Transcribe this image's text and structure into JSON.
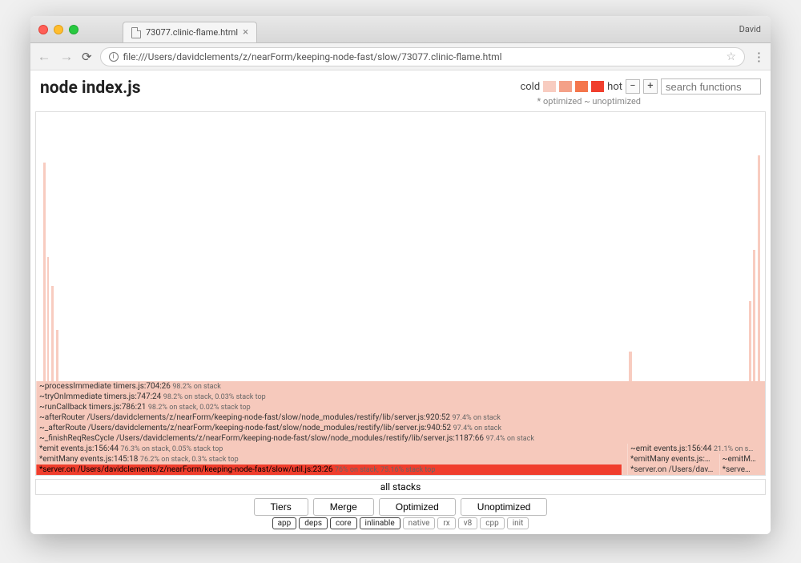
{
  "browser": {
    "tab_title": "73077.clinic-flame.html",
    "user": "David",
    "url": "file:///Users/davidclements/z/nearForm/keeping-node-fast/slow/73077.clinic-flame.html"
  },
  "header": {
    "title": "node index.js",
    "cold_label": "cold",
    "hot_label": "hot",
    "minus": "−",
    "plus": "+",
    "search_placeholder": "search functions",
    "legend_sub": "* optimized ~ unoptimized"
  },
  "frames": [
    {
      "cols": [
        {
          "text": "*server.on /Users/davidclements/z/nearForm/keeping-node-fast/slow/util.js:23:26",
          "meta": "76% on stack, 75.16% stack top",
          "width": "80.4%",
          "class": "chot"
        },
        {
          "text": "",
          "meta": "",
          "width": "0.7%",
          "class": "c0"
        },
        {
          "text": "*server.on /Users/dav…",
          "meta": "",
          "width": "12.6%",
          "class": "c0"
        },
        {
          "text": "*serve…",
          "meta": "",
          "width": "6.3%",
          "class": "c0"
        }
      ]
    },
    {
      "cols": [
        {
          "text": "*emitMany events.js:145:18",
          "meta": "76.2% on stack, 0.3% stack top",
          "width": "81.1%",
          "class": "c0"
        },
        {
          "text": "*emitMany events.js:…",
          "meta": "",
          "width": "12.6%",
          "class": "c0"
        },
        {
          "text": "~emitM…",
          "meta": "",
          "width": "6.3%",
          "class": "c0"
        }
      ]
    },
    {
      "cols": [
        {
          "text": "*emit events.js:156:44",
          "meta": "76.3% on stack, 0.05% stack top",
          "width": "81.1%",
          "class": "c0"
        },
        {
          "text": "~emit events.js:156:44",
          "meta": "21.1% on s…",
          "width": "18.9%",
          "class": "c0"
        }
      ]
    },
    {
      "cols": [
        {
          "text": "~_finishReqResCycle /Users/davidclements/z/nearForm/keeping-node-fast/slow/node_modules/restify/lib/server.js:1187:66",
          "meta": "97.4% on stack",
          "width": "100%",
          "class": "c0"
        }
      ]
    },
    {
      "cols": [
        {
          "text": "~_afterRoute /Users/davidclements/z/nearForm/keeping-node-fast/slow/node_modules/restify/lib/server.js:940:52",
          "meta": "97.4% on stack",
          "width": "100%",
          "class": "c0"
        }
      ]
    },
    {
      "cols": [
        {
          "text": "~afterRouter /Users/davidclements/z/nearForm/keeping-node-fast/slow/node_modules/restify/lib/server.js:920:52",
          "meta": "97.4% on stack",
          "width": "100%",
          "class": "c0"
        }
      ]
    },
    {
      "cols": [
        {
          "text": "~runCallback timers.js:786:21",
          "meta": "98.2% on stack, 0.02% stack top",
          "width": "100%",
          "class": "c0"
        }
      ]
    },
    {
      "cols": [
        {
          "text": "~tryOnImmediate timers.js:747:24",
          "meta": "98.2% on stack, 0.03% stack top",
          "width": "100%",
          "class": "c0"
        }
      ]
    },
    {
      "cols": [
        {
          "text": "~processImmediate timers.js:704:26",
          "meta": "98.2% on stack",
          "width": "100%",
          "class": "c0"
        }
      ]
    }
  ],
  "all_stacks": "all stacks",
  "controls": {
    "tiers": "Tiers",
    "merge": "Merge",
    "optimized": "Optimized",
    "unoptimized": "Unoptimized"
  },
  "tiers": [
    {
      "label": "app",
      "on": true
    },
    {
      "label": "deps",
      "on": true
    },
    {
      "label": "core",
      "on": true
    },
    {
      "label": "inlinable",
      "on": true
    },
    {
      "label": "native",
      "on": false
    },
    {
      "label": "rx",
      "on": false
    },
    {
      "label": "v8",
      "on": false
    },
    {
      "label": "cpp",
      "on": false
    },
    {
      "label": "init",
      "on": false
    }
  ]
}
